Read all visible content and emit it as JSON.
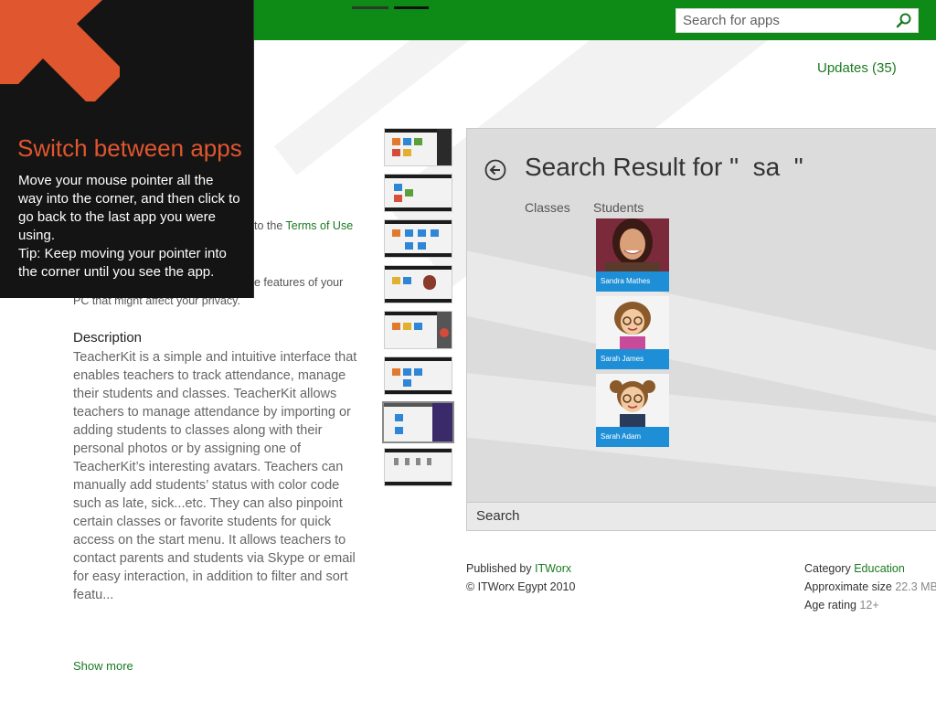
{
  "search": {
    "placeholder": "Search for apps"
  },
  "updates_label": "Updates (35)",
  "tip": {
    "title": "Switch between apps",
    "body": "Move your mouse pointer all the way into the corner, and then click to go back to the last app you were using.",
    "tip_text": "Tip: Keep moving your pointer into the corner until you see the app."
  },
  "left_fragments": {
    "terms_prefix": "to the ",
    "terms_link": "Terms of Use",
    "privacy_line1": "e features of your",
    "privacy_line2": "PC that might affect your privacy."
  },
  "description": {
    "heading": "Description",
    "text": "TeacherKit is a simple and intuitive interface that enables teachers to track attendance, manage their students and classes. TeacherKit allows teachers to manage attendance by importing or adding students to classes along with their personal photos or by assigning one of TeacherKit’s interesting avatars. Teachers can manually add students’ status with color code such as late, sick...etc. They can also pinpoint certain classes or favorite students for quick access on the start menu. It allows teachers to contact parents and students via Skype or email for easy interaction, in addition to filter and sort featu...",
    "show_more": "Show more"
  },
  "screenshot": {
    "title": "Search Result for \"  sa  \"",
    "col_classes": "Classes",
    "col_students": "Students",
    "students": [
      {
        "name": "Sandra Mathes"
      },
      {
        "name": "Sarah James"
      },
      {
        "name": "Sarah Adam"
      }
    ],
    "bottom_label": "Search"
  },
  "meta": {
    "published_label": "Published by ",
    "publisher": "ITWorx",
    "copyright": "© ITWorx Egypt 2010",
    "category_label": "Category ",
    "category": "Education",
    "size_label": "Approximate size ",
    "size": "22.3 MB",
    "age_label": "Age rating ",
    "age": "12+"
  },
  "colors": {
    "brand_green": "#0e8a16",
    "link_green": "#1a7a1f",
    "tip_orange": "#e0562e",
    "tile_blue": "#1e8fd6"
  }
}
